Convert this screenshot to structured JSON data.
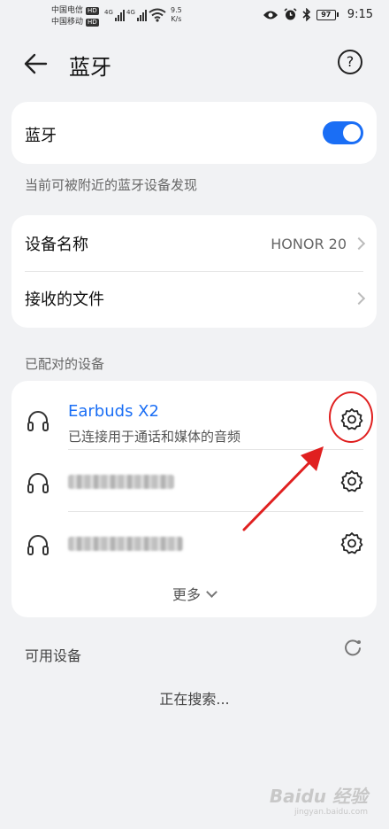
{
  "status_bar": {
    "carrier1": "中国电信",
    "carrier2": "中国移动",
    "hd": "HD",
    "net1": "4G",
    "net2": "4G",
    "speed_value": "9.5",
    "speed_unit": "K/s",
    "battery": "97",
    "time": "9:15"
  },
  "header": {
    "title": "蓝牙",
    "help": "?"
  },
  "bluetooth_card": {
    "label": "蓝牙",
    "toggle_on": true
  },
  "discoverable_text": "当前可被附近的蓝牙设备发现",
  "info_card": {
    "device_name_label": "设备名称",
    "device_name_value": "HONOR 20",
    "received_files_label": "接收的文件"
  },
  "paired_section_label": "已配对的设备",
  "paired_devices": [
    {
      "name": "Earbuds X2",
      "status": "已连接用于通话和媒体的音频",
      "icon": "headphones-icon"
    },
    {
      "name": "",
      "blurred": true,
      "icon": "headphones-icon"
    },
    {
      "name": "",
      "blurred": true,
      "icon": "headphones-icon"
    }
  ],
  "more_label": "更多",
  "available_section_label": "可用设备",
  "searching_text": "正在搜索...",
  "watermark": {
    "brand": "Baidu 经验",
    "url": "jingyan.baidu.com"
  },
  "colors": {
    "accent": "#1a6ef5",
    "annotation": "#e02020",
    "background": "#f1f2f4"
  }
}
